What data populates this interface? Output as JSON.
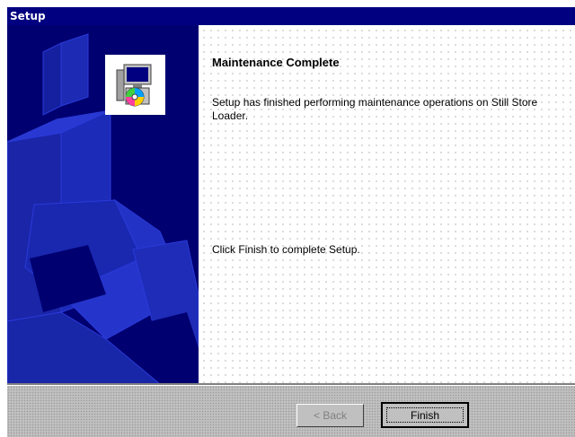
{
  "window": {
    "title": "Setup"
  },
  "content": {
    "heading": "Maintenance Complete",
    "message": "Setup has finished performing maintenance operations on Still Store Loader.",
    "instruction": "Click Finish to complete Setup."
  },
  "buttons": {
    "back_label": "< Back",
    "finish_label": "Finish"
  },
  "colors": {
    "titlebar": "#000080",
    "side_panel": "#000070",
    "face": "#c0c0c0"
  },
  "icons": {
    "setup_icon": "installer-computer-disc-icon"
  }
}
